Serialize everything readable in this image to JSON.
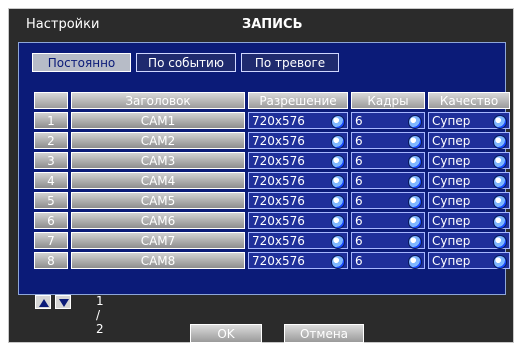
{
  "window": {
    "title_left": "Настройки",
    "title_center": "ЗАПИСЬ"
  },
  "tabs": [
    {
      "label": "Постоянно",
      "active": true
    },
    {
      "label": "По событию",
      "active": false
    },
    {
      "label": "По тревоге",
      "active": false
    }
  ],
  "table": {
    "headers": {
      "index": "",
      "name": "Заголовок",
      "resolution": "Разрешение",
      "frames": "Кадры",
      "quality": "Качество"
    },
    "rows": [
      {
        "index": "1",
        "name": "CAM1",
        "resolution": "720x576",
        "frames": "6",
        "quality": "Супер"
      },
      {
        "index": "2",
        "name": "CAM2",
        "resolution": "720x576",
        "frames": "6",
        "quality": "Супер"
      },
      {
        "index": "3",
        "name": "CAM3",
        "resolution": "720x576",
        "frames": "6",
        "quality": "Супер"
      },
      {
        "index": "4",
        "name": "CAM4",
        "resolution": "720x576",
        "frames": "6",
        "quality": "Супер"
      },
      {
        "index": "5",
        "name": "CAM5",
        "resolution": "720x576",
        "frames": "6",
        "quality": "Супер"
      },
      {
        "index": "6",
        "name": "CAM6",
        "resolution": "720x576",
        "frames": "6",
        "quality": "Супер"
      },
      {
        "index": "7",
        "name": "CAM7",
        "resolution": "720x576",
        "frames": "6",
        "quality": "Супер"
      },
      {
        "index": "8",
        "name": "CAM8",
        "resolution": "720x576",
        "frames": "6",
        "quality": "Супер"
      }
    ]
  },
  "pager": {
    "text": "1 / 2",
    "up_icon": "triangle-up-icon",
    "down_icon": "triangle-down-icon"
  },
  "buttons": {
    "ok": "OK",
    "cancel": "Отмена"
  },
  "colors": {
    "dialog_bg": "#2b2b2b",
    "panel_bg": "#0b1b78",
    "panel_border": "#8ea6d8",
    "value_cell_bg": "#1f2f9a",
    "value_cell_border": "#a7b7ff",
    "spinner_blue": "#1a4cff"
  }
}
